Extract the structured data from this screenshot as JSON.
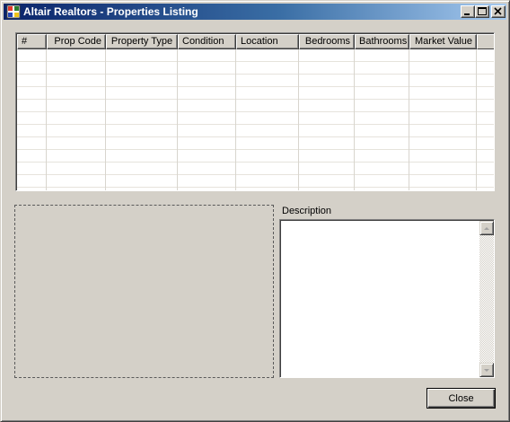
{
  "window": {
    "title": "Altair Realtors - Properties Listing",
    "icon": "app-window-icon",
    "controls": {
      "minimize_icon": "minimize-icon",
      "maximize_icon": "maximize-icon",
      "close_icon": "close-icon"
    }
  },
  "grid": {
    "columns": [
      {
        "label": "#",
        "align": "left"
      },
      {
        "label": "Prop Code",
        "align": "right"
      },
      {
        "label": "Property Type",
        "align": "center"
      },
      {
        "label": "Condition",
        "align": "left"
      },
      {
        "label": "Location",
        "align": "left"
      },
      {
        "label": "Bedrooms",
        "align": "right"
      },
      {
        "label": "Bathrooms",
        "align": "right"
      },
      {
        "label": "Market Value",
        "align": "right"
      }
    ],
    "rows": []
  },
  "description": {
    "label": "Description",
    "value": ""
  },
  "buttons": {
    "close_label": "Close"
  },
  "colors": {
    "face": "#d4d0c8",
    "title_start": "#0a246a",
    "title_end": "#a6caf0"
  }
}
